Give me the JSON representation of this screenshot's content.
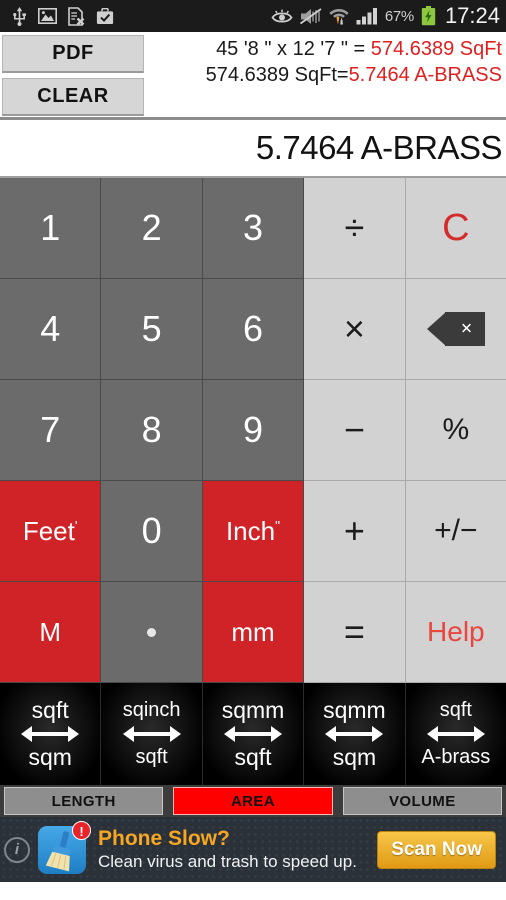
{
  "statusbar": {
    "left_icons": [
      "usb-icon",
      "image-icon",
      "document-error-icon",
      "briefcase-check-icon"
    ],
    "right_icons": [
      "eye-icon",
      "mute-icon",
      "wifi-transfer-icon",
      "signal-bars-icon",
      "battery-charging-icon"
    ],
    "battery_percent": "67%",
    "time": "17:24"
  },
  "toolbar": {
    "pdf_label": "PDF",
    "clear_label": "CLEAR"
  },
  "history": {
    "line1": {
      "expr_plain": "45 '8 \" x 12 '7 \" = ",
      "expr_red": "574.6389 SqFt"
    },
    "line2": {
      "expr_plain": "574.6389 SqFt=",
      "expr_red": "5.7464 A-BRASS"
    }
  },
  "result": {
    "value": "5.7464 A-BRASS"
  },
  "keypad": {
    "rows": [
      [
        {
          "label": "1",
          "name": "key-1",
          "style": "dark"
        },
        {
          "label": "2",
          "name": "key-2",
          "style": "dark"
        },
        {
          "label": "3",
          "name": "key-3",
          "style": "dark"
        },
        {
          "label": "÷",
          "name": "key-divide",
          "style": "light"
        },
        {
          "label": "C",
          "name": "key-clear",
          "style": "clear"
        }
      ],
      [
        {
          "label": "4",
          "name": "key-4",
          "style": "dark"
        },
        {
          "label": "5",
          "name": "key-5",
          "style": "dark"
        },
        {
          "label": "6",
          "name": "key-6",
          "style": "dark"
        },
        {
          "label": "×",
          "name": "key-multiply",
          "style": "light"
        },
        {
          "label": "",
          "name": "key-backspace",
          "style": "backspace"
        }
      ],
      [
        {
          "label": "7",
          "name": "key-7",
          "style": "dark"
        },
        {
          "label": "8",
          "name": "key-8",
          "style": "dark"
        },
        {
          "label": "9",
          "name": "key-9",
          "style": "dark"
        },
        {
          "label": "−",
          "name": "key-minus",
          "style": "light"
        },
        {
          "label": "%",
          "name": "key-percent",
          "style": "light"
        }
      ],
      [
        {
          "label": "Feet",
          "sup": "'",
          "name": "key-feet",
          "style": "red"
        },
        {
          "label": "0",
          "name": "key-0",
          "style": "dark"
        },
        {
          "label": "Inch",
          "sup": "\"",
          "name": "key-inch",
          "style": "red"
        },
        {
          "label": "+",
          "name": "key-plus",
          "style": "light"
        },
        {
          "label": "+/−",
          "name": "key-sign",
          "style": "light"
        }
      ],
      [
        {
          "label": "M",
          "name": "key-meter",
          "style": "red"
        },
        {
          "label": "",
          "name": "key-decimal-point",
          "style": "dot"
        },
        {
          "label": "mm",
          "name": "key-millimeter",
          "style": "red"
        },
        {
          "label": "=",
          "name": "key-equals",
          "style": "light"
        },
        {
          "label": "Help",
          "name": "key-help",
          "style": "help"
        }
      ]
    ]
  },
  "conversions": [
    {
      "from": "sqft",
      "to": "sqm",
      "name": "convert-sqft-to-sqm"
    },
    {
      "from": "sqinch",
      "to": "sqft",
      "name": "convert-sqinch-to-sqft"
    },
    {
      "from": "sqmm",
      "to": "sqft",
      "name": "convert-sqmm-to-sqft"
    },
    {
      "from": "sqmm",
      "to": "sqm",
      "name": "convert-sqmm-to-sqm"
    },
    {
      "from": "sqft",
      "to": "A-brass",
      "name": "convert-sqft-to-abrass"
    }
  ],
  "tabs": [
    {
      "label": "LENGTH",
      "name": "tab-length",
      "active": false
    },
    {
      "label": "AREA",
      "name": "tab-area",
      "active": true
    },
    {
      "label": "VOLUME",
      "name": "tab-volume",
      "active": false
    }
  ],
  "ad": {
    "headline": "Phone Slow?",
    "subtext": "Clean virus and trash to speed up.",
    "cta_label": "Scan Now",
    "badge": "!",
    "info_label": "i"
  },
  "colors": {
    "accent_red": "#d02327",
    "active_tab_red": "#ff0000",
    "history_red": "#e02020",
    "key_dark": "#6b6b6b",
    "key_light": "#d2d2d2",
    "ad_orange": "#f5a623"
  }
}
